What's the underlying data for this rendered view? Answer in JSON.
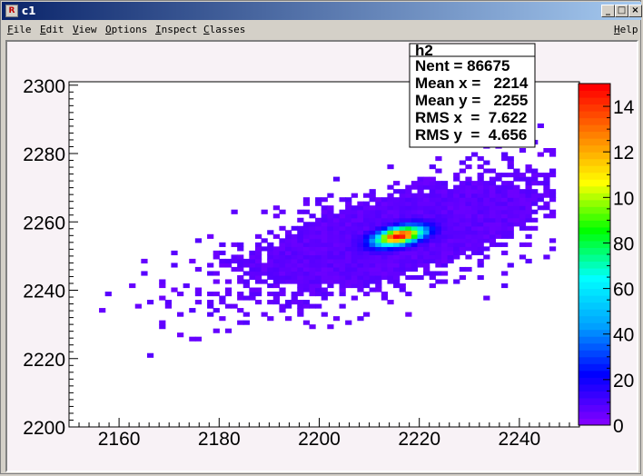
{
  "window": {
    "title": "c1",
    "buttons": {
      "minimize": "_",
      "maximize": "□",
      "close": "×"
    }
  },
  "menubar": {
    "items": [
      "File",
      "Edit",
      "View",
      "Options",
      "Inspect",
      "Classes"
    ],
    "help": "Help"
  },
  "stats_box": {
    "title": "h2",
    "lines": [
      "Nent = 86675",
      "Mean x =   2214",
      "Mean y =   2255",
      "RMS x  =  7.622",
      "RMS y  =  4.656"
    ]
  },
  "chart_data": {
    "type": "heatmap",
    "xlim": [
      2150,
      2252
    ],
    "ylim": [
      2200,
      2301
    ],
    "x_ticks": [
      2160,
      2180,
      2200,
      2220,
      2240
    ],
    "y_ticks": [
      2200,
      2220,
      2240,
      2260,
      2280,
      2300
    ],
    "color_scale": {
      "min": 0,
      "max": 150,
      "tick_labels": [
        "0",
        "20",
        "40",
        "60",
        "80",
        "10",
        "12",
        "14"
      ],
      "palette": [
        "#7f00ff",
        "#0000ff",
        "#00a0ff",
        "#00ffff",
        "#00ff00",
        "#ffff00",
        "#ff8000",
        "#ff0000"
      ]
    },
    "grid": false,
    "peak": {
      "x": 2216,
      "y": 2256
    }
  }
}
